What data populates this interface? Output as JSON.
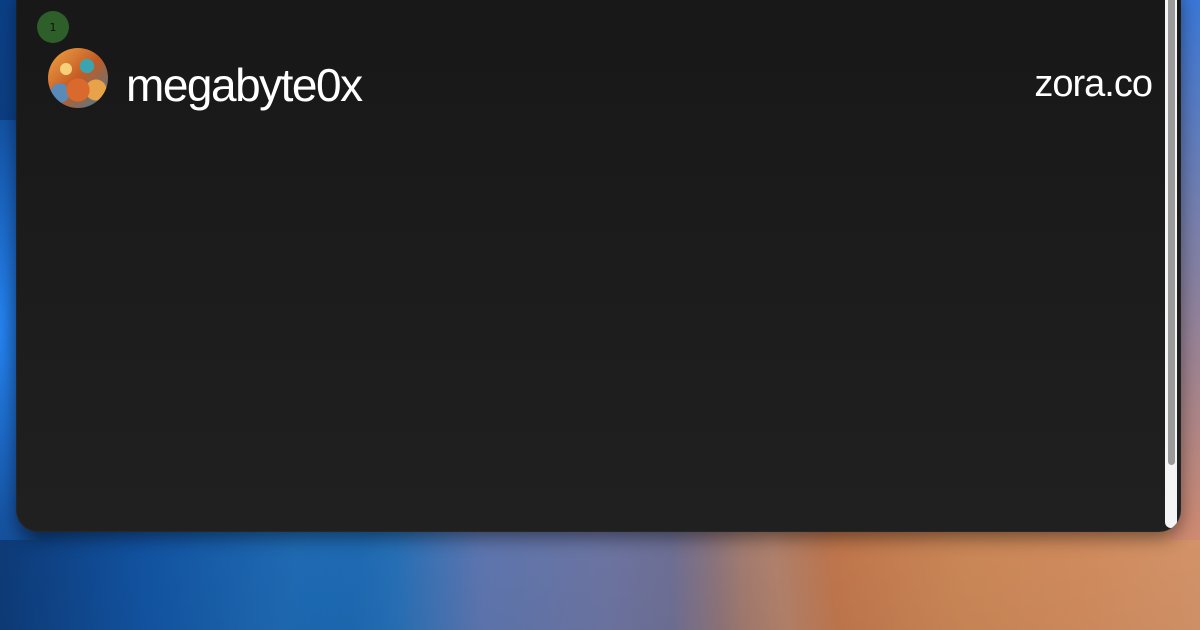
{
  "badge": {
    "count": "1"
  },
  "profile": {
    "avatar_icon": "profile-avatar-icon",
    "username": "megabyte0x"
  },
  "site": {
    "domain": "zora.co"
  },
  "colors": {
    "card_background": "#1b1b1b",
    "text": "#ffffff",
    "badge_background": "#2e5e2a",
    "scrollbar_track": "#f4f4f4",
    "scrollbar_thumb": "#9a9a9a"
  }
}
